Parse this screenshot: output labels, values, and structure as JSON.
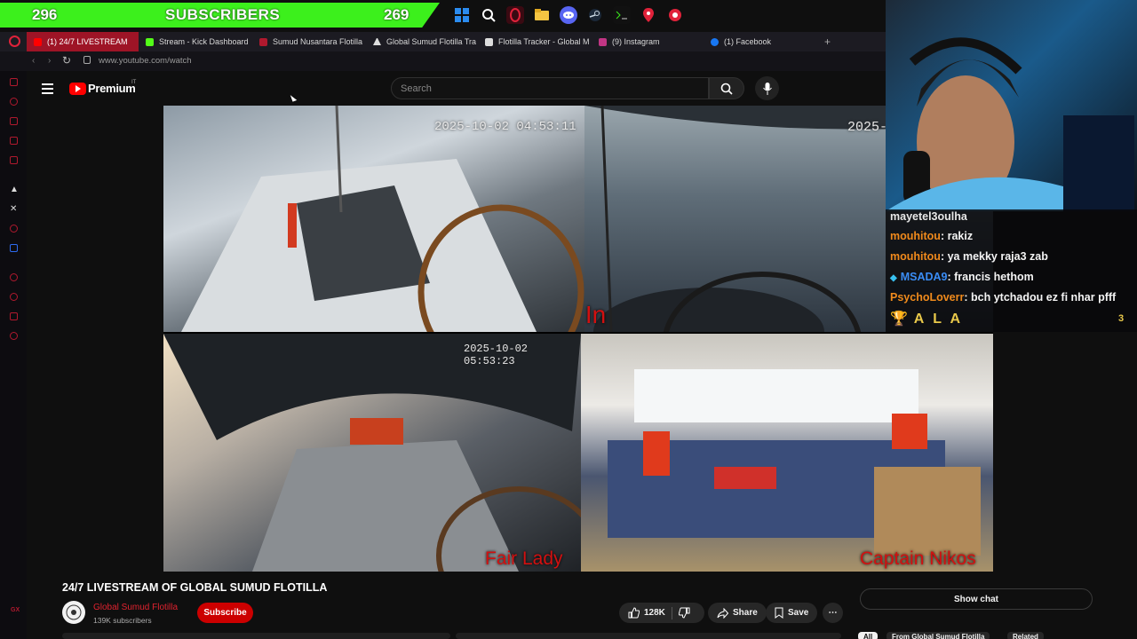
{
  "overlay": {
    "sub_left": "296",
    "sub_label": "SUBSCRIBERS",
    "sub_right": "269"
  },
  "taskbar": [
    "windows-icon",
    "search-icon",
    "opera-icon",
    "folder-icon",
    "discord-icon",
    "steam-icon",
    "terminal-icon",
    "maps-pin-icon",
    "chrome-icon"
  ],
  "browser": {
    "tabs": [
      {
        "label": "(1) 24/7 LIVESTREAM",
        "color": "#ff0000"
      },
      {
        "label": "Stream - Kick Dashboard",
        "color": "#53fc18"
      },
      {
        "label": "Sumud Nusantara Flotilla",
        "color": "#b0192e"
      },
      {
        "label": "Global Sumud Flotilla Tra",
        "color": "#dddddd"
      },
      {
        "label": "Flotilla Tracker - Global M",
        "color": "#dddddd"
      },
      {
        "label": "(9) Instagram",
        "color": "#c13584"
      },
      {
        "label": "(1) Facebook",
        "color": "#1877f2"
      }
    ],
    "new_tab": "+",
    "url": "www.youtube.com/watch"
  },
  "youtube": {
    "logo_text": "Premium",
    "region": "IT",
    "search_placeholder": "Search"
  },
  "video": {
    "cams": [
      {
        "timestamp": "2025-10-02 04:53:11",
        "boat": ""
      },
      {
        "timestamp": "2025-",
        "boat": "All In"
      },
      {
        "timestamp": "2025-10-02 05:53:23",
        "boat": "Fair Lady"
      },
      {
        "timestamp": "",
        "boat": "Captain Nikos"
      }
    ]
  },
  "chat": {
    "messages": [
      {
        "user": "mayetel3oulha",
        "msg": "",
        "color": "white"
      },
      {
        "user": "mouhitou",
        "msg": ": rakiz",
        "color": "orange"
      },
      {
        "user": "mouhitou",
        "msg": ": ya mekky raja3 zab",
        "color": "orange"
      },
      {
        "user": "MSADA9",
        "msg": ": francis hethom",
        "color": "blue"
      },
      {
        "user": "PsychoLoverr",
        "msg": ": bch ytchadou ez fi nhar pfff",
        "color": "orange"
      }
    ],
    "banner": "A L A",
    "count": "3"
  },
  "watch": {
    "title": "24/7 LIVESTREAM OF GLOBAL SUMUD FLOTILLA",
    "channel": "Global Sumud Flotilla",
    "subscribers": "139K subscribers",
    "subscribe": "Subscribe",
    "likes": "128K",
    "share": "Share",
    "save": "Save",
    "more": "⋯",
    "show_chat": "Show chat",
    "chips": [
      "All",
      "From Global Sumud Flotilla",
      "Related"
    ]
  },
  "sidebar_gx": "GX"
}
